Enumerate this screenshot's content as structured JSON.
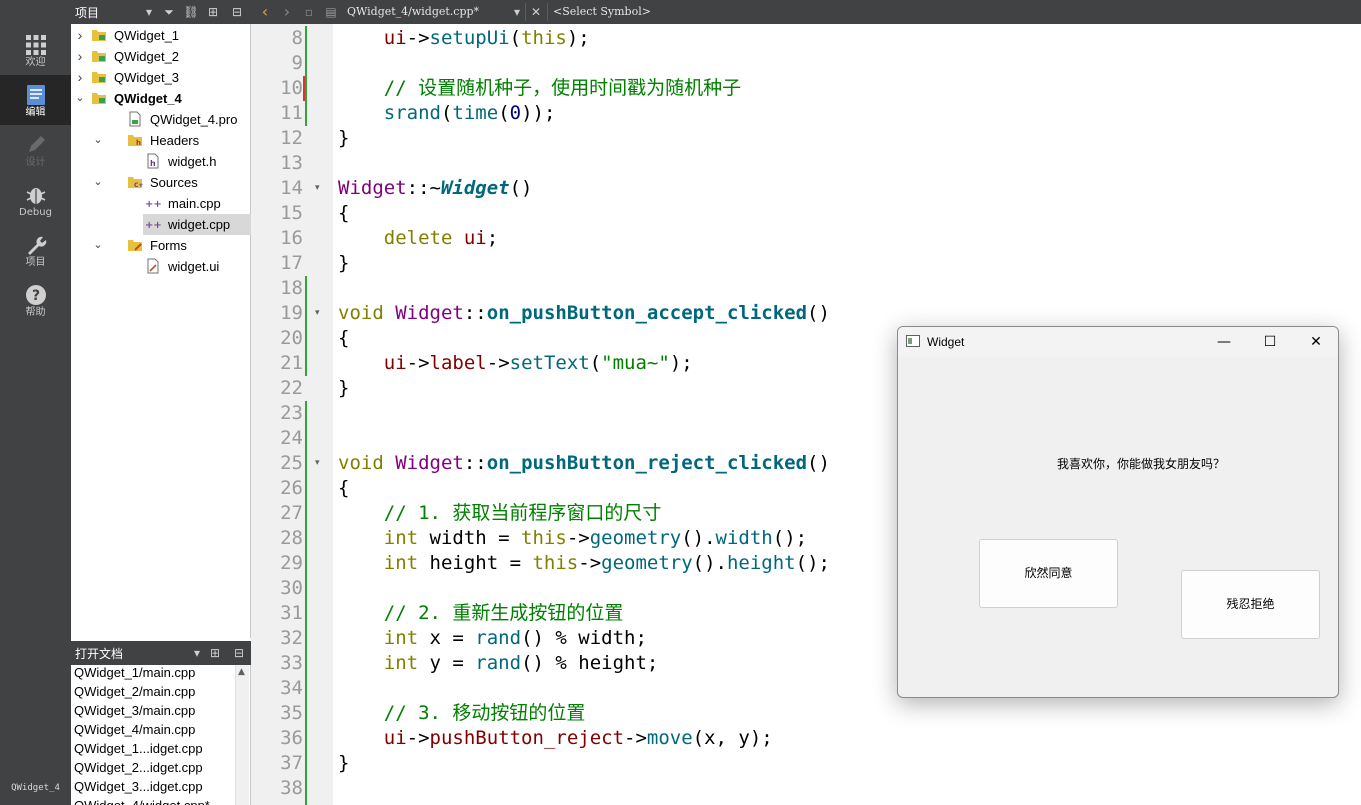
{
  "modes": [
    {
      "label": "欢迎",
      "icon": "welcome-grid-icon",
      "active": false
    },
    {
      "label": "编辑",
      "icon": "edit-document-icon",
      "active": true
    },
    {
      "label": "设计",
      "icon": "design-pen-icon",
      "active": false
    },
    {
      "label": "Debug",
      "icon": "debug-bug-icon",
      "active": false
    },
    {
      "label": "项目",
      "icon": "project-wrench-icon",
      "active": false
    },
    {
      "label": "帮助",
      "icon": "help-question-icon",
      "active": false
    }
  ],
  "kit": "QWidget_4",
  "projects": {
    "header": "项目",
    "tree": [
      {
        "label": "QWidget_1",
        "depth": 0,
        "expanded": false,
        "type": "project"
      },
      {
        "label": "QWidget_2",
        "depth": 0,
        "expanded": false,
        "type": "project"
      },
      {
        "label": "QWidget_3",
        "depth": 0,
        "expanded": false,
        "type": "project"
      },
      {
        "label": "QWidget_4",
        "depth": 0,
        "expanded": true,
        "type": "project",
        "bold": true
      },
      {
        "label": "QWidget_4.pro",
        "depth": 1,
        "type": "pro-file"
      },
      {
        "label": "Headers",
        "depth": 1,
        "expanded": true,
        "type": "folder-h"
      },
      {
        "label": "widget.h",
        "depth": 2,
        "type": "header-file"
      },
      {
        "label": "Sources",
        "depth": 1,
        "expanded": true,
        "type": "folder-cpp"
      },
      {
        "label": "main.cpp",
        "depth": 2,
        "type": "cpp-file"
      },
      {
        "label": "widget.cpp",
        "depth": 2,
        "type": "cpp-file",
        "selected": true
      },
      {
        "label": "Forms",
        "depth": 1,
        "expanded": true,
        "type": "folder-forms"
      },
      {
        "label": "widget.ui",
        "depth": 2,
        "type": "ui-file"
      }
    ]
  },
  "open_docs": {
    "header": "打开文档",
    "items": [
      "QWidget_1/main.cpp",
      "QWidget_2/main.cpp",
      "QWidget_3/main.cpp",
      "QWidget_4/main.cpp",
      "QWidget_1...idget.cpp",
      "QWidget_2...idget.cpp",
      "QWidget_3...idget.cpp",
      "QWidget_4/widget.cpp*"
    ]
  },
  "editor": {
    "file_label": "QWidget_4/widget.cpp*",
    "symbol_label": "<Select Symbol>",
    "first_line": 8,
    "lines": [
      {
        "n": 8,
        "tokens": [
          [
            "",
            "    "
          ],
          [
            "mem",
            "ui"
          ],
          [
            "",
            "->"
          ],
          [
            "fn",
            "setupUi"
          ],
          [
            "",
            "("
          ],
          [
            "kw",
            "this"
          ],
          [
            "",
            ");"
          ]
        ]
      },
      {
        "n": 9,
        "tokens": []
      },
      {
        "n": 10,
        "tokens": [
          [
            "",
            "    "
          ],
          [
            "com",
            "// 设置随机种子，使用时间戳为随机种子"
          ]
        ]
      },
      {
        "n": 11,
        "tokens": [
          [
            "",
            "    "
          ],
          [
            "fn",
            "srand"
          ],
          [
            "",
            "("
          ],
          [
            "fn",
            "time"
          ],
          [
            "",
            "("
          ],
          [
            "num",
            "0"
          ],
          [
            "",
            "));"
          ]
        ]
      },
      {
        "n": 12,
        "tokens": [
          [
            "",
            "}"
          ]
        ]
      },
      {
        "n": 13,
        "tokens": []
      },
      {
        "n": 14,
        "fold": true,
        "tokens": [
          [
            "typ",
            "Widget"
          ],
          [
            "",
            "::~"
          ],
          [
            "fni",
            "Widget"
          ],
          [
            "",
            "()"
          ]
        ]
      },
      {
        "n": 15,
        "tokens": [
          [
            "",
            "{"
          ]
        ]
      },
      {
        "n": 16,
        "tokens": [
          [
            "",
            "    "
          ],
          [
            "kw",
            "delete"
          ],
          [
            "",
            " "
          ],
          [
            "mem",
            "ui"
          ],
          [
            "",
            ";"
          ]
        ]
      },
      {
        "n": 17,
        "tokens": [
          [
            "",
            "}"
          ]
        ]
      },
      {
        "n": 18,
        "tokens": []
      },
      {
        "n": 19,
        "fold": true,
        "tokens": [
          [
            "kw",
            "void"
          ],
          [
            "",
            " "
          ],
          [
            "typ",
            "Widget"
          ],
          [
            "",
            "::"
          ],
          [
            "fnb",
            "on_pushButton_accept_clicked"
          ],
          [
            "",
            "()"
          ]
        ]
      },
      {
        "n": 20,
        "tokens": [
          [
            "",
            "{"
          ]
        ]
      },
      {
        "n": 21,
        "tokens": [
          [
            "",
            "    "
          ],
          [
            "mem",
            "ui"
          ],
          [
            "",
            "->"
          ],
          [
            "mem",
            "label"
          ],
          [
            "",
            "->"
          ],
          [
            "fn",
            "setText"
          ],
          [
            "",
            "("
          ],
          [
            "str",
            "\"mua~\""
          ],
          [
            "",
            ");"
          ]
        ]
      },
      {
        "n": 22,
        "tokens": [
          [
            "",
            "}"
          ]
        ]
      },
      {
        "n": 23,
        "tokens": []
      },
      {
        "n": 24,
        "tokens": []
      },
      {
        "n": 25,
        "fold": true,
        "tokens": [
          [
            "kw",
            "void"
          ],
          [
            "",
            " "
          ],
          [
            "typ",
            "Widget"
          ],
          [
            "",
            "::"
          ],
          [
            "fnb",
            "on_pushButton_reject_clicked"
          ],
          [
            "",
            "()"
          ]
        ]
      },
      {
        "n": 26,
        "tokens": [
          [
            "",
            "{"
          ]
        ]
      },
      {
        "n": 27,
        "tokens": [
          [
            "",
            "    "
          ],
          [
            "com",
            "// 1. 获取当前程序窗口的尺寸"
          ]
        ]
      },
      {
        "n": 28,
        "tokens": [
          [
            "",
            "    "
          ],
          [
            "kw",
            "int"
          ],
          [
            "",
            " width = "
          ],
          [
            "kw",
            "this"
          ],
          [
            "",
            "->"
          ],
          [
            "fn",
            "geometry"
          ],
          [
            "",
            "()."
          ],
          [
            "fn",
            "width"
          ],
          [
            "",
            "();"
          ]
        ]
      },
      {
        "n": 29,
        "tokens": [
          [
            "",
            "    "
          ],
          [
            "kw",
            "int"
          ],
          [
            "",
            " height = "
          ],
          [
            "kw",
            "this"
          ],
          [
            "",
            "->"
          ],
          [
            "fn",
            "geometry"
          ],
          [
            "",
            "()."
          ],
          [
            "fn",
            "height"
          ],
          [
            "",
            "();"
          ]
        ]
      },
      {
        "n": 30,
        "tokens": []
      },
      {
        "n": 31,
        "tokens": [
          [
            "",
            "    "
          ],
          [
            "com",
            "// 2. 重新生成按钮的位置"
          ]
        ]
      },
      {
        "n": 32,
        "tokens": [
          [
            "",
            "    "
          ],
          [
            "kw",
            "int"
          ],
          [
            "",
            " x = "
          ],
          [
            "fn",
            "rand"
          ],
          [
            "",
            "() % width;"
          ]
        ]
      },
      {
        "n": 33,
        "tokens": [
          [
            "",
            "    "
          ],
          [
            "kw",
            "int"
          ],
          [
            "",
            " y = "
          ],
          [
            "fn",
            "rand"
          ],
          [
            "",
            "() % height;"
          ]
        ]
      },
      {
        "n": 34,
        "tokens": []
      },
      {
        "n": 35,
        "tokens": [
          [
            "",
            "    "
          ],
          [
            "com",
            "// 3. 移动按钮的位置"
          ]
        ]
      },
      {
        "n": 36,
        "tokens": [
          [
            "",
            "    "
          ],
          [
            "mem",
            "ui"
          ],
          [
            "",
            "->"
          ],
          [
            "mem",
            "pushButton_reject"
          ],
          [
            "",
            "->"
          ],
          [
            "fn",
            "move"
          ],
          [
            "",
            "(x, y);"
          ]
        ]
      },
      {
        "n": 37,
        "tokens": [
          [
            "",
            "}"
          ]
        ]
      },
      {
        "n": 38,
        "tokens": []
      }
    ]
  },
  "widget_window": {
    "title": "Widget",
    "minimize": "—",
    "maximize": "☐",
    "close": "✕",
    "label": "我喜欢你，你能做我女朋友吗？",
    "accept_button": "欣然同意",
    "reject_button": "残忍拒绝"
  }
}
